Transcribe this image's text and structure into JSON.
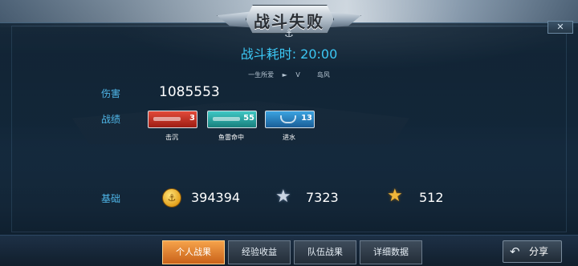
{
  "header": {
    "title": "战斗失败",
    "close_icon": "close-icon"
  },
  "battle": {
    "duration": "战斗耗时: 20:00",
    "player_left": "一生所爱",
    "vs_arrow": "►",
    "vs": "V",
    "player_right": "岛风"
  },
  "stats": {
    "damage_label": "伤害",
    "damage_value": "1085553",
    "achievements_label": "战绩",
    "achievements": [
      {
        "name": "击沉",
        "count": "3",
        "icon": "sink-medal-icon",
        "color": "#d83a2c"
      },
      {
        "name": "鱼雷命中",
        "count": "55",
        "icon": "torpedo-medal-icon",
        "color": "#2fb4b0"
      },
      {
        "name": "进水",
        "count": "13",
        "icon": "flooding-medal-icon",
        "color": "#2f8fd0"
      }
    ],
    "base_label": "基础",
    "base": [
      {
        "icon": "gold-coin-icon",
        "value": "394394"
      },
      {
        "icon": "silver-star-icon",
        "value": "7323"
      },
      {
        "icon": "gold-star-icon",
        "value": "512"
      }
    ]
  },
  "tabs": [
    {
      "label": "个人战果",
      "active": true
    },
    {
      "label": "经验收益",
      "active": false
    },
    {
      "label": "队伍战果",
      "active": false
    },
    {
      "label": "详细数据",
      "active": false
    }
  ],
  "share": {
    "label": "分享",
    "icon": "share-arrow-icon"
  },
  "colors": {
    "accent_blue": "#3cc7f4",
    "label_blue": "#4fb6e8",
    "active_tab": "#e8893a"
  }
}
